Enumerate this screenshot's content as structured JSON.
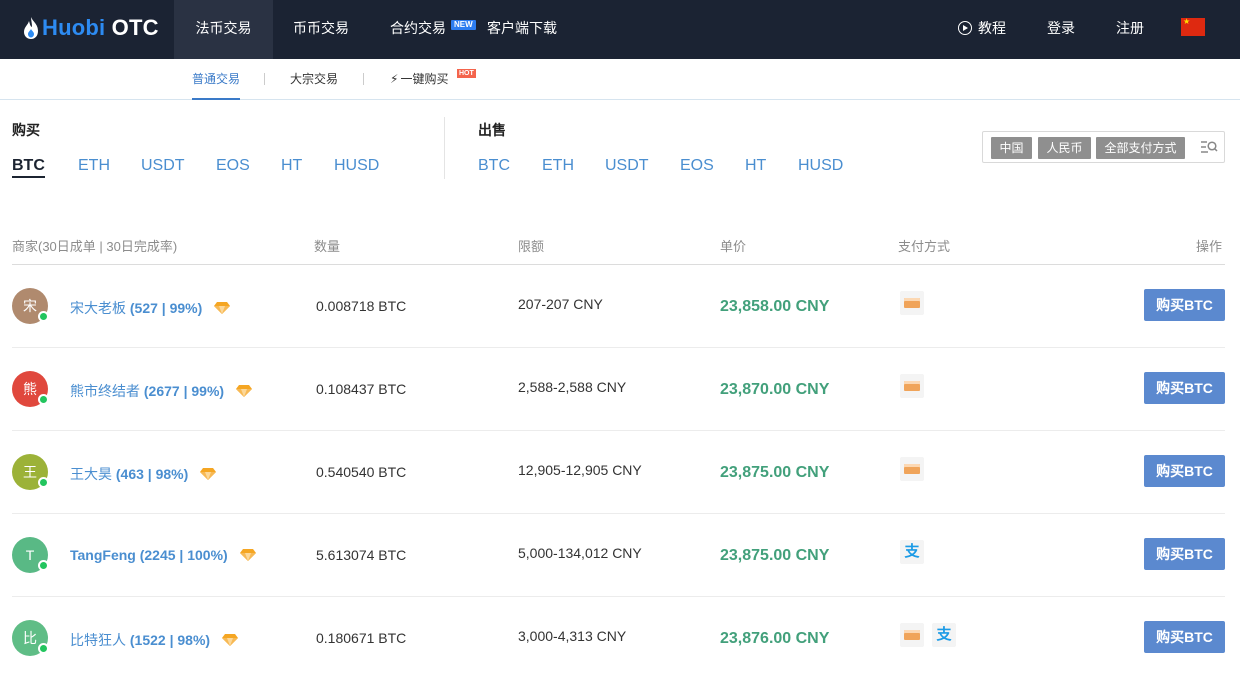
{
  "brand": {
    "logo_prefix": "Huobi",
    "logo_suffix": " OTC"
  },
  "top_nav": {
    "items": [
      "法币交易",
      "币币交易",
      "合约交易",
      "客户端下载"
    ],
    "new_badge": "NEW",
    "tutorial": "教程",
    "login": "登录",
    "register": "注册",
    "flag": "china-flag-icon"
  },
  "sub_nav": {
    "items": [
      "普通交易",
      "大宗交易",
      "一键购买"
    ],
    "hot_badge": "HOT"
  },
  "buy_section": {
    "label": "购买",
    "coins": [
      "BTC",
      "ETH",
      "USDT",
      "EOS",
      "HT",
      "HUSD"
    ],
    "active": "BTC"
  },
  "sell_section": {
    "label": "出售",
    "coins": [
      "BTC",
      "ETH",
      "USDT",
      "EOS",
      "HT",
      "HUSD"
    ]
  },
  "filter": {
    "country": "中国",
    "currency": "人民币",
    "payment": "全部支付方式"
  },
  "table": {
    "headers": [
      "商家(30日成单 | 30日完成率)",
      "数量",
      "限额",
      "单价",
      "支付方式",
      "操作"
    ],
    "rows": [
      {
        "avatar": "宋",
        "avatar_color": "#b08a6e",
        "name": "宋大老板",
        "stats": " (527 | 99%)",
        "amount": "0.008718 BTC",
        "limit": "207-207 CNY",
        "price": "23,858.00 CNY",
        "payments": [
          "bank-card-icon"
        ],
        "action": "购买BTC"
      },
      {
        "avatar": "熊",
        "avatar_color": "#e0483d",
        "name": "熊市终结者",
        "stats": " (2677 | 99%)",
        "amount": "0.108437 BTC",
        "limit": "2,588-2,588 CNY",
        "price": "23,870.00 CNY",
        "payments": [
          "bank-card-icon"
        ],
        "action": "购买BTC"
      },
      {
        "avatar": "王",
        "avatar_color": "#9cb238",
        "name": "王大昊",
        "stats": " (463 | 98%)",
        "amount": "0.540540 BTC",
        "limit": "12,905-12,905 CNY",
        "price": "23,875.00 CNY",
        "payments": [
          "bank-card-icon"
        ],
        "action": "购买BTC"
      },
      {
        "avatar": "T",
        "avatar_color": "#59b985",
        "name": "TangFeng",
        "stats": " (2245 | 100%)",
        "amount": "5.613074 BTC",
        "limit": "5,000-134,012 CNY",
        "price": "23,875.00 CNY",
        "payments": [
          "alipay-icon"
        ],
        "action": "购买BTC"
      },
      {
        "avatar": "比",
        "avatar_color": "#5fbd86",
        "name": "比特狂人",
        "stats": " (1522 | 98%)",
        "amount": "0.180671 BTC",
        "limit": "3,000-4,313 CNY",
        "price": "23,876.00 CNY",
        "payments": [
          "bank-card-icon",
          "alipay-icon"
        ],
        "action": "购买BTC"
      }
    ]
  },
  "colors": {
    "topbar": "#1b2333",
    "link_blue": "#4a8ed0",
    "price_green": "#42a07b",
    "button_blue": "#5b89cf",
    "online_green": "#22c55e"
  }
}
